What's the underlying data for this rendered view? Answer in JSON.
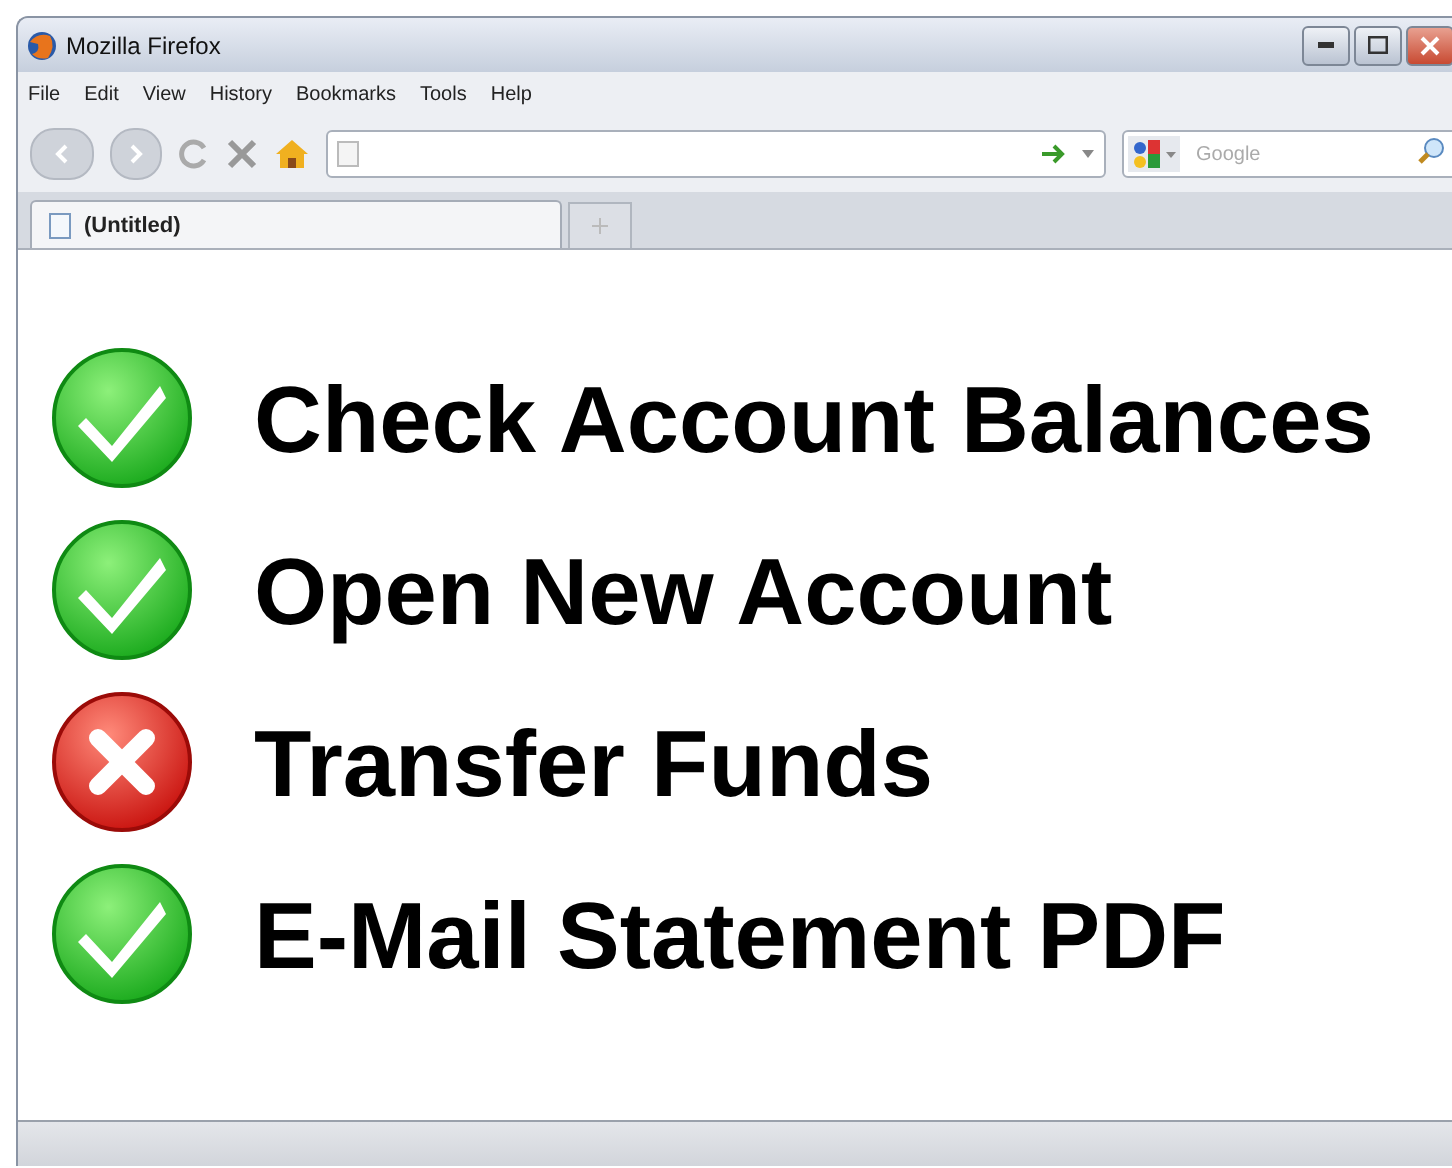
{
  "window": {
    "title": "Mozilla Firefox"
  },
  "menu": [
    "File",
    "Edit",
    "View",
    "History",
    "Bookmarks",
    "Tools",
    "Help"
  ],
  "search": {
    "placeholder": "Google"
  },
  "tabs": [
    {
      "label": "(Untitled)",
      "selected": true
    }
  ],
  "items": [
    {
      "label": "Check Account Balances",
      "passed": true
    },
    {
      "label": "Open New Account",
      "passed": true
    },
    {
      "label": "Transfer Funds",
      "passed": false
    },
    {
      "label": "E-Mail Statement PDF",
      "passed": true
    }
  ]
}
